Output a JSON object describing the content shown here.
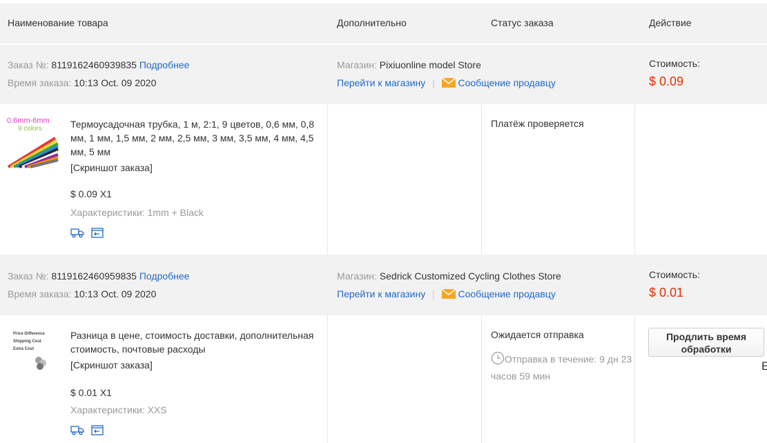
{
  "header": {
    "col_product": "Наименование товара",
    "col_additional": "Дополнительно",
    "col_status": "Статус заказа",
    "col_action": "Действие"
  },
  "orders": [
    {
      "order_label": "Заказ №:",
      "order_number": "8119162460939835",
      "details_link": "Подробнее",
      "time_label": "Время заказа:",
      "order_time": "10:13 Oct. 09 2020",
      "store_label": "Магазин:",
      "store_name": "Pixiuonline model Store",
      "go_store": "Перейти к магазину",
      "separator": "|",
      "message_seller": "Сообщение продавцу",
      "cost_label": "Стоимость:",
      "cost_value": "$ 0.09",
      "item": {
        "thumb_line1": "0.6mm-6mm",
        "thumb_line2": "9 colors",
        "title": "Термоусадочная трубка, 1 м, 2:1, 9 цветов, 0,6 мм, 0,8 мм, 1 мм, 1,5 мм, 2 мм, 2,5 мм, 3 мм, 3,5 мм, 4 мм, 4,5 мм, 5 мм",
        "snapshot": "[Скриншот заказа]",
        "price_qty": "$ 0.09 X1",
        "specs": "Характеристики: 1mm + Black",
        "status": "Платёж проверяется"
      }
    },
    {
      "order_label": "Заказ №:",
      "order_number": "8119162460959835",
      "details_link": "Подробнее",
      "time_label": "Время заказа:",
      "order_time": "10:13 Oct. 09 2020",
      "store_label": "Магазин:",
      "store_name": "Sedrick Customized Cycling Clothes Store",
      "go_store": "Перейти к магазину",
      "separator": "|",
      "message_seller": "Сообщение продавцу",
      "cost_label": "Стоимость:",
      "cost_value": "$ 0.01",
      "item": {
        "thumb_line1": "Price Difference",
        "thumb_line2": "Shipping Cost",
        "thumb_line3": "Extra Cost",
        "title": "Разница в цене, стоимость доставки, дополнительная стоимость, почтовые расходы",
        "snapshot": "[Скриншот заказа]",
        "price_qty": "$ 0.01 X1",
        "specs": "Характеристики: XXS",
        "status": "Ожидается отправка",
        "countdown": "Отправка в течение: 9 дн 23 часов 59 мин",
        "action_button": "Продлить время обработки",
        "edge_letter": "E"
      }
    }
  ],
  "colors": {
    "link": "#2168c8",
    "price": "#e62e04",
    "band": "#f2f2f2",
    "mail": "#f5a623",
    "icon": "#2168c8"
  }
}
